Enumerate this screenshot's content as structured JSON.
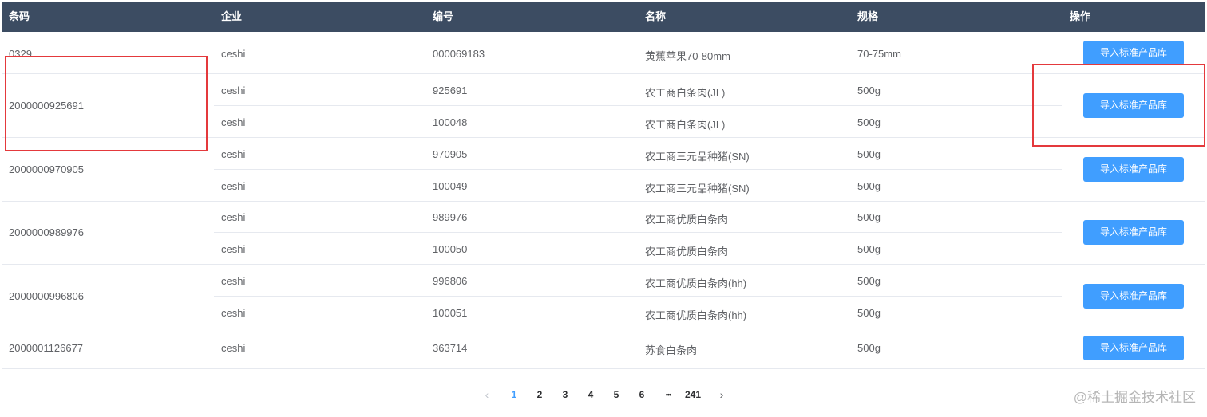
{
  "table": {
    "headers": [
      "条码",
      "企业",
      "编号",
      "名称",
      "规格",
      "操作"
    ],
    "groups": [
      {
        "barcode": "0329",
        "rows": [
          {
            "company": "ceshi",
            "code": "000069183",
            "name": "黄蕉苹果70-80mm",
            "spec": "70-75mm"
          }
        ],
        "action": "导入标准产品库"
      },
      {
        "barcode": "2000000925691",
        "rows": [
          {
            "company": "ceshi",
            "code": "925691",
            "name": "农工商白条肉(JL)",
            "spec": "500g"
          },
          {
            "company": "ceshi",
            "code": "100048",
            "name": "农工商白条肉(JL)",
            "spec": "500g"
          }
        ],
        "action": "导入标准产品库"
      },
      {
        "barcode": "2000000970905",
        "rows": [
          {
            "company": "ceshi",
            "code": "970905",
            "name": "农工商三元品种猪(SN)",
            "spec": "500g"
          },
          {
            "company": "ceshi",
            "code": "100049",
            "name": "农工商三元品种猪(SN)",
            "spec": "500g"
          }
        ],
        "action": "导入标准产品库"
      },
      {
        "barcode": "2000000989976",
        "rows": [
          {
            "company": "ceshi",
            "code": "989976",
            "name": "农工商优质白条肉",
            "spec": "500g"
          },
          {
            "company": "ceshi",
            "code": "100050",
            "name": "农工商优质白条肉",
            "spec": "500g"
          }
        ],
        "action": "导入标准产品库"
      },
      {
        "barcode": "2000000996806",
        "rows": [
          {
            "company": "ceshi",
            "code": "996806",
            "name": "农工商优质白条肉(hh)",
            "spec": "500g"
          },
          {
            "company": "ceshi",
            "code": "100051",
            "name": "农工商优质白条肉(hh)",
            "spec": "500g"
          }
        ],
        "action": "导入标准产品库"
      },
      {
        "barcode": "2000001126677",
        "rows": [
          {
            "company": "ceshi",
            "code": "363714",
            "name": "苏食白条肉",
            "spec": "500g"
          }
        ],
        "action": "导入标准产品库"
      }
    ]
  },
  "pagination": {
    "prev": "‹",
    "pages": [
      "1",
      "2",
      "3",
      "4",
      "5",
      "6"
    ],
    "ellipsis": "•••",
    "last": "241",
    "next": "›",
    "current": "1"
  },
  "watermark": "@稀土掘金技术社区",
  "colors": {
    "header_bg": "#3c4c62",
    "accent": "#409eff",
    "annotation": "#e4393c"
  }
}
